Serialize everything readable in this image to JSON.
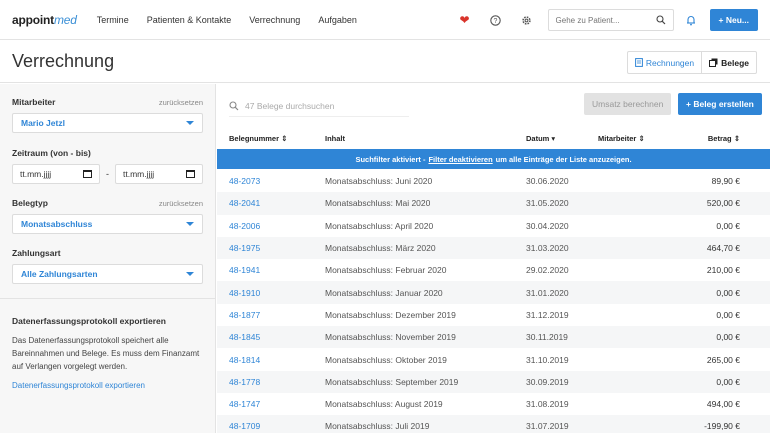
{
  "app": {
    "logo_main": "appoint",
    "logo_accent": "med"
  },
  "nav": {
    "items": [
      "Termine",
      "Patienten & Kontakte",
      "Verrechnung",
      "Aufgaben"
    ],
    "search_placeholder": "Gehe zu Patient...",
    "new_button": "+ Neu..."
  },
  "page": {
    "title": "Verrechnung",
    "view_toggle": {
      "rechnungen": "Rechnungen",
      "belege": "Belege"
    }
  },
  "sidebar": {
    "mitarbeiter": {
      "label": "Mitarbeiter",
      "reset": "zurücksetzen",
      "value": "Mario Jetzl"
    },
    "zeitraum": {
      "label": "Zeitraum (von - bis)",
      "from": "tt.mm.jjjj",
      "to": "tt.mm.jjjj",
      "separator": "-"
    },
    "belegtyp": {
      "label": "Belegtyp",
      "reset": "zurücksetzen",
      "value": "Monatsabschluss"
    },
    "zahlungsart": {
      "label": "Zahlungsart",
      "value": "Alle Zahlungsarten"
    },
    "export": {
      "heading": "Datenerfassungsprotokoll exportieren",
      "text": "Das Datenerfassungsprotokoll speichert alle Bareinnahmen und Belege. Es muss dem Finanzamt auf Verlangen vorgelegt werden.",
      "link": "Datenerfassungsprotokoll exportieren"
    }
  },
  "main": {
    "search_placeholder": "47 Belege durchsuchen",
    "umsatz_button": "Umsatz berechnen",
    "beleg_button": "+ Beleg erstellen",
    "columns": {
      "belegnummer": "Belegnummer ⇕",
      "inhalt": "Inhalt",
      "datum": "Datum ▾",
      "mitarbeiter": "Mitarbeiter ⇕",
      "betrag": "Betrag ⇕"
    },
    "banner": {
      "pre": "Suchfilter aktiviert -",
      "link": "Filter deaktivieren",
      "post": "um alle Einträge der Liste anzuzeigen."
    },
    "rows": [
      {
        "num": "48-2073",
        "inhalt": "Monatsabschluss: Juni 2020",
        "datum": "30.06.2020",
        "betrag": "89,90 €"
      },
      {
        "num": "48-2041",
        "inhalt": "Monatsabschluss: Mai 2020",
        "datum": "31.05.2020",
        "betrag": "520,00 €"
      },
      {
        "num": "48-2006",
        "inhalt": "Monatsabschluss: April 2020",
        "datum": "30.04.2020",
        "betrag": "0,00 €"
      },
      {
        "num": "48-1975",
        "inhalt": "Monatsabschluss: März 2020",
        "datum": "31.03.2020",
        "betrag": "464,70 €"
      },
      {
        "num": "48-1941",
        "inhalt": "Monatsabschluss: Februar 2020",
        "datum": "29.02.2020",
        "betrag": "210,00 €"
      },
      {
        "num": "48-1910",
        "inhalt": "Monatsabschluss: Januar 2020",
        "datum": "31.01.2020",
        "betrag": "0,00 €"
      },
      {
        "num": "48-1877",
        "inhalt": "Monatsabschluss: Dezember 2019",
        "datum": "31.12.2019",
        "betrag": "0,00 €"
      },
      {
        "num": "48-1845",
        "inhalt": "Monatsabschluss: November 2019",
        "datum": "30.11.2019",
        "betrag": "0,00 €"
      },
      {
        "num": "48-1814",
        "inhalt": "Monatsabschluss: Oktober 2019",
        "datum": "31.10.2019",
        "betrag": "265,00 €"
      },
      {
        "num": "48-1778",
        "inhalt": "Monatsabschluss: September 2019",
        "datum": "30.09.2019",
        "betrag": "0,00 €"
      },
      {
        "num": "48-1747",
        "inhalt": "Monatsabschluss: August 2019",
        "datum": "31.08.2019",
        "betrag": "494,00 €"
      },
      {
        "num": "48-1709",
        "inhalt": "Monatsabschluss: Juli 2019",
        "datum": "31.07.2019",
        "betrag": "-199,90 €"
      }
    ]
  },
  "colors": {
    "accent": "#2f85d6",
    "heart": "#d9342b"
  }
}
